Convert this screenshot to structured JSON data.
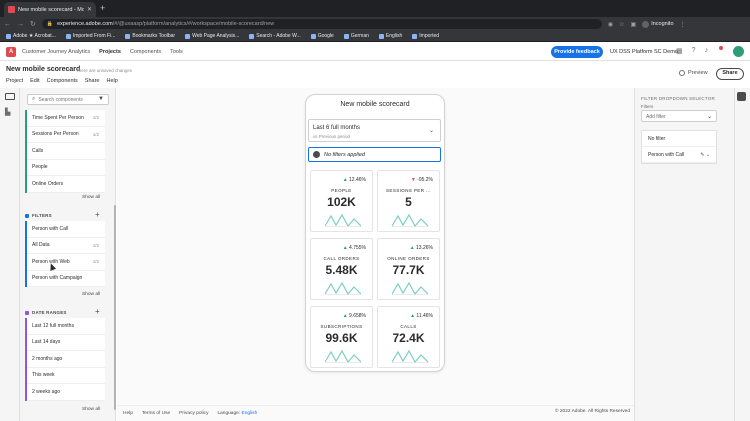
{
  "browser": {
    "tab_title": "New mobile scorecard - Mob...",
    "new_tab": "+",
    "url_domain": "experience.adobe.com",
    "url_path": "/#/@uxaasp/platform/analytics/#/workspace/mobile-scorecard/new",
    "profile_label": "Incognito",
    "bookmarks": [
      "Adobe ★ Acrobat...",
      "Imported From Fi...",
      "Bookmarks Toolbar",
      "Web Page Analysis...",
      "Search - Adobe W...",
      "Google",
      "German",
      "English",
      "Imported"
    ]
  },
  "app": {
    "product": "Customer Journey Analytics",
    "nav": [
      "Projects",
      "Components",
      "Tools"
    ],
    "feedback_button": "Provide feedback",
    "org": "UX DSS Platform SC Demo",
    "notification_count": "3"
  },
  "project": {
    "title": "New mobile scorecard",
    "unsaved": "There are unsaved changes",
    "menu": [
      "Project",
      "Edit",
      "Components",
      "Share",
      "Help"
    ],
    "preview_label": "Preview",
    "share_label": "Share"
  },
  "components": {
    "search_placeholder": "Search components",
    "metrics": [
      {
        "label": "Time Spent Per Person",
        "count": "1/2"
      },
      {
        "label": "Sessions Per Person",
        "count": "1/2"
      },
      {
        "label": "Calls",
        "count": ""
      },
      {
        "label": "People",
        "count": ""
      },
      {
        "label": "Online Orders",
        "count": ""
      }
    ],
    "metrics_show_all": "Show all",
    "filters_head": "FILTERS",
    "filters": [
      {
        "label": "Person with Call",
        "count": ""
      },
      {
        "label": "All Data",
        "count": "1/2"
      },
      {
        "label": "Person with Web",
        "count": "1/2"
      },
      {
        "label": "Person with Campaign",
        "count": ""
      }
    ],
    "filters_show_all": "Show all",
    "dates_head": "DATE RANGES",
    "date_ranges": [
      {
        "label": "Last 12 full months",
        "count": ""
      },
      {
        "label": "Last 14 days",
        "count": ""
      },
      {
        "label": "2 months ago",
        "count": ""
      },
      {
        "label": "This week",
        "count": ""
      },
      {
        "label": "2 weeks ago",
        "count": ""
      }
    ],
    "dates_show_all": "Show all"
  },
  "scorecard": {
    "title": "New mobile scorecard",
    "date_range": "Last 6 full months",
    "compare": "vs Previous period",
    "filter_text": "No filters applied",
    "tiles": [
      {
        "label": "PEOPLE",
        "value": "102K",
        "change": "12.46%",
        "dir": "▲",
        "dir_color": "#2d9d78"
      },
      {
        "label": "SESSIONS PER ...",
        "value": "5",
        "change": "-95.2%",
        "dir": "▼",
        "dir_color": "#e34850"
      },
      {
        "label": "CALL ORDERS",
        "value": "5.48K",
        "change": "4.755%",
        "dir": "▲",
        "dir_color": "#2d9d78"
      },
      {
        "label": "ONLINE ORDERS",
        "value": "77.7K",
        "change": "13.26%",
        "dir": "▲",
        "dir_color": "#2d9d78"
      },
      {
        "label": "SUBSCRIPTIONS",
        "value": "99.6K",
        "change": "9.658%",
        "dir": "▲",
        "dir_color": "#2d9d78"
      },
      {
        "label": "CALLS",
        "value": "72.4K",
        "change": "11.46%",
        "dir": "▲",
        "dir_color": "#2d9d78"
      }
    ],
    "spark_color": "#7ccfc1"
  },
  "right_panel": {
    "title": "FILTER DROPDOWN SELECTOR",
    "filters_label": "Filters",
    "select_value": "Add filter",
    "options": [
      "No filter",
      "Person with Call"
    ]
  },
  "footer": {
    "links": [
      "Help",
      "Terms of Use",
      "Privacy policy"
    ],
    "language_label": "Language:",
    "language_value": "English",
    "copyright": "© 2022 Adobe. All Rights Reserved"
  },
  "colors": {
    "accent": "#1473e6",
    "metrics": "#2d9d78",
    "filters": "#1473e6",
    "dates": "#9256d9"
  }
}
